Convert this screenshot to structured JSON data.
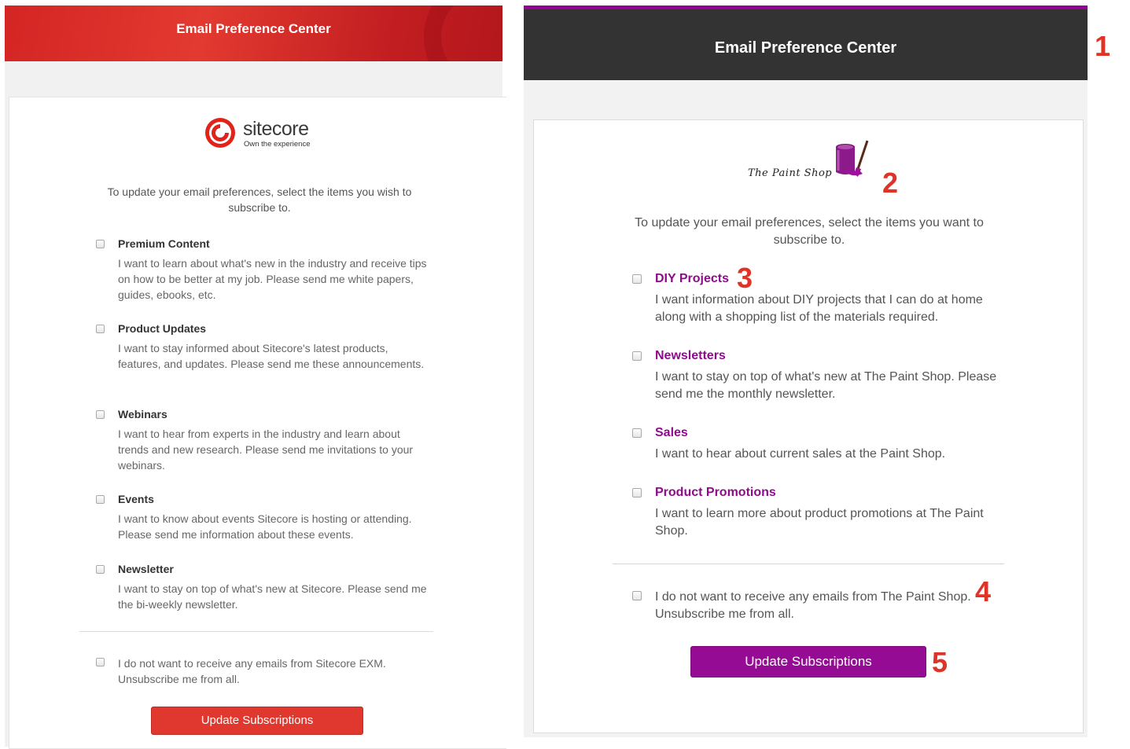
{
  "left": {
    "header_title": "Email Preference Center",
    "logo": {
      "wordmark": "sitecore",
      "tagline": "Own the experience"
    },
    "intro": "To update your email preferences, select the items you wish to subscribe to.",
    "items": [
      {
        "label": "Premium Content",
        "description": "I want to learn about what's new in the industry and receive tips on how to be better at my job. Please send me white papers, guides, ebooks, etc."
      },
      {
        "label": "Product Updates",
        "description": "I want to stay informed about Sitecore's latest products, features, and updates. Please send me these announcements."
      },
      {
        "label": "Webinars",
        "description": "I want to hear from experts in the industry and learn about trends and new research. Please send me invitations to your webinars."
      },
      {
        "label": "Events",
        "description": "I want to know about events Sitecore is hosting or attending. Please send me information about these events."
      },
      {
        "label": "Newsletter",
        "description": "I want to stay on top of what's new at Sitecore. Please send me the bi-weekly newsletter."
      }
    ],
    "unsubscribe": "I do not want to receive any emails from Sitecore EXM. Unsubscribe me from all.",
    "button": "Update Subscriptions",
    "colors": {
      "header": "#d42524",
      "button": "#e0382f"
    }
  },
  "right": {
    "header_title": "Email Preference Center",
    "logo": {
      "text": "The Paint Shop"
    },
    "intro": "To update your email preferences, select the items you want to subscribe to.",
    "items": [
      {
        "label": "DIY Projects",
        "description": "I want information about DIY projects that I can do at home along with a shopping list of the materials required."
      },
      {
        "label": "Newsletters",
        "description": "I want to stay on top of what's new at The Paint Shop. Please send me the monthly newsletter."
      },
      {
        "label": "Sales",
        "description": "I want to hear about current sales at the Paint Shop."
      },
      {
        "label": "Product Promotions",
        "description": "I want to learn more about product promotions at The Paint Shop."
      }
    ],
    "unsubscribe": "I do not want to receive any emails from The Paint Shop. Unsubscribe me from all.",
    "button": "Update Subscriptions",
    "colors": {
      "header": "#333333",
      "accent": "#920691",
      "button": "#960b94"
    }
  },
  "callouts": [
    "1",
    "2",
    "3",
    "4",
    "5"
  ]
}
